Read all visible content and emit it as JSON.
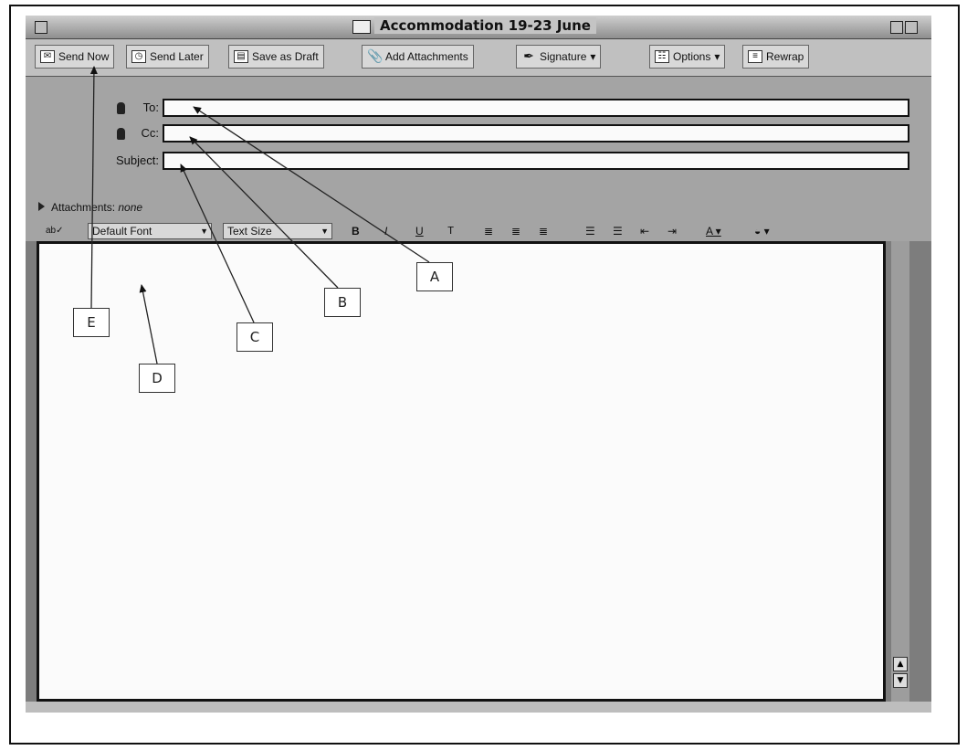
{
  "window": {
    "title": "Accommodation 19-23 June"
  },
  "toolbar": {
    "send_now": "Send Now",
    "send_later": "Send Later",
    "save_as_draft": "Save as Draft",
    "add_attachments": "Add Attachments",
    "signature": "Signature",
    "options": "Options",
    "rewrap": "Rewrap"
  },
  "fields": {
    "to_label": "To:",
    "cc_label": "Cc:",
    "subject_label": "Subject:",
    "to_value": "",
    "cc_value": "",
    "subject_value": ""
  },
  "attachments": {
    "label": "Attachments:",
    "value": "none"
  },
  "format_bar": {
    "font": "Default Font",
    "size": "Text Size",
    "bold": "B",
    "italic": "I",
    "underline": "U",
    "teletype": "T"
  },
  "callouts": {
    "a": "A",
    "b": "B",
    "c": "C",
    "d": "D",
    "e": "E"
  },
  "colors": {
    "window_bg": "#7d7d7d",
    "body_bg": "#fbfbfb",
    "toolbar_bg": "#c0c0c0"
  }
}
